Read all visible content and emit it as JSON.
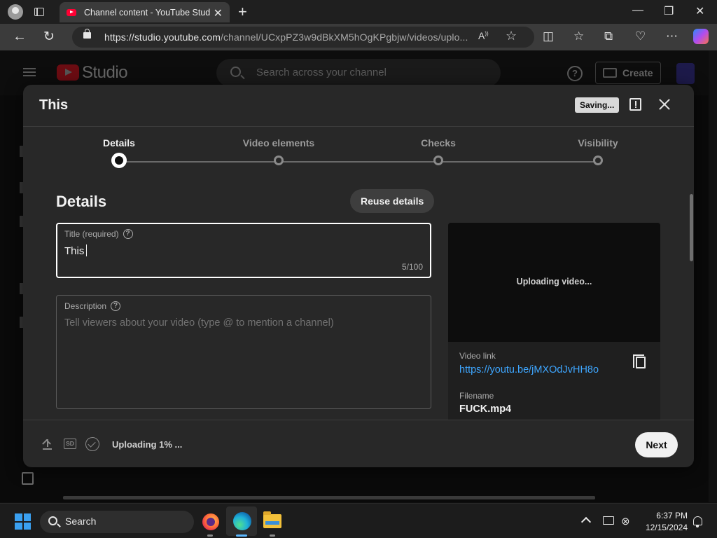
{
  "browser": {
    "tab_title": "Channel content - YouTube Studio",
    "tab_close": "✕",
    "new_tab": "+",
    "url_host": "https://studio.youtube.com",
    "url_path": "/channel/UCxpPZ3w9dBkXM5hOgKPgbjw/videos/uplo...",
    "read_aloud": "A",
    "favorite_star": "☆",
    "window_minimize": "—",
    "window_restore": "❐",
    "window_close": "✕",
    "back_arrow": "←",
    "reload": "↻"
  },
  "studio": {
    "wordmark": "Studio",
    "search_placeholder": "Search across your channel",
    "help": "?",
    "create_label": "Create"
  },
  "dialog": {
    "title": "This",
    "saving_badge": "Saving...",
    "steps": [
      {
        "label": "Details",
        "active": true
      },
      {
        "label": "Video elements",
        "active": false
      },
      {
        "label": "Checks",
        "active": false
      },
      {
        "label": "Visibility",
        "active": false
      }
    ],
    "section_heading": "Details",
    "reuse_button": "Reuse details",
    "title_field": {
      "label": "Title (required)",
      "value": "This",
      "counter": "5/100"
    },
    "description_field": {
      "label": "Description",
      "placeholder": "Tell viewers about your video (type @ to mention a channel)"
    },
    "preview": {
      "status": "Uploading video...",
      "video_link_label": "Video link",
      "video_link": "https://youtu.be/jMXOdJvHH8o",
      "filename_label": "Filename",
      "filename": "FUCK.mp4"
    },
    "footer": {
      "sd_badge": "SD",
      "upload_status": "Uploading 1% ...",
      "next_button": "Next"
    }
  },
  "taskbar": {
    "search_label": "Search",
    "time": "6:37 PM",
    "date": "12/15/2024",
    "network": "⊗"
  },
  "colors": {
    "youtube_red": "#ff0033",
    "link_blue": "#3ea6ff",
    "windows_blue": "#3aa0f0"
  },
  "icons": [
    "profile-avatar-icon",
    "tab-actions-icon",
    "youtube-favicon",
    "lock-icon",
    "read-aloud-icon",
    "favorite-star-icon",
    "split-screen-icon",
    "favorites-icon",
    "collections-icon",
    "browser-essentials-icon",
    "more-icon",
    "copilot-icon",
    "hamburger-icon",
    "search-icon",
    "help-icon",
    "create-video-icon",
    "feedback-icon",
    "close-icon",
    "help-circle-icon",
    "copy-icon",
    "upload-icon",
    "sd-icon",
    "checks-icon",
    "windows-logo-icon",
    "firefox-icon",
    "edge-icon",
    "file-explorer-icon",
    "chevron-up-icon",
    "monitor-icon",
    "network-icon",
    "bell-icon"
  ]
}
